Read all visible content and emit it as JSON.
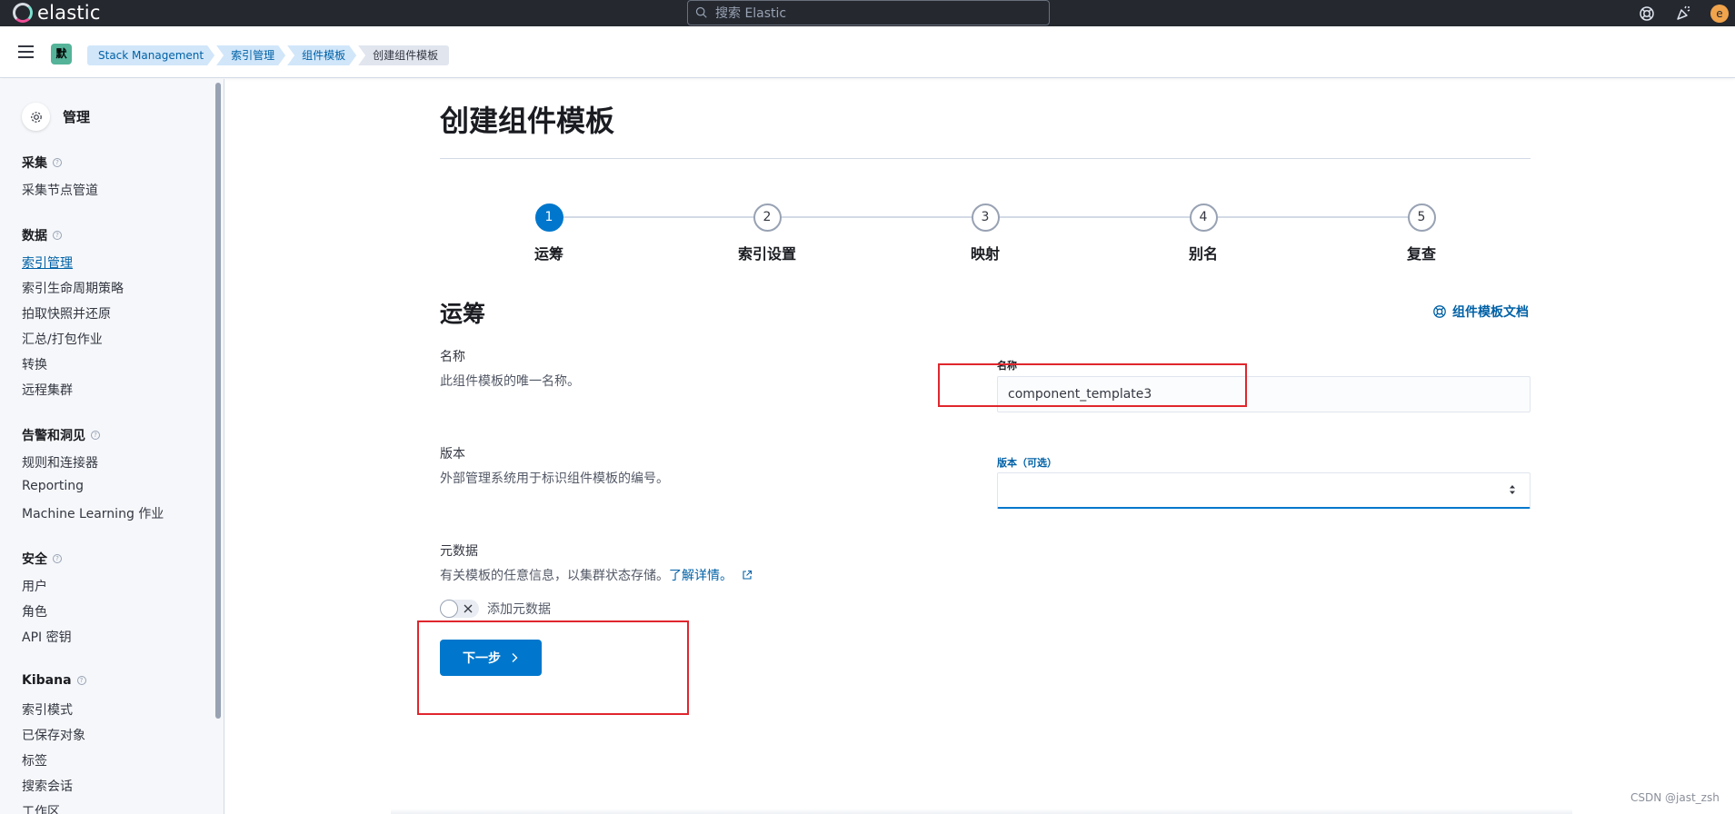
{
  "header": {
    "logo_text": "elastic",
    "search_placeholder": "搜索 Elastic",
    "avatar_initial": "e",
    "icons": [
      "help-icon",
      "newsfeed-icon"
    ]
  },
  "breadcrumb": {
    "space_badge": "默",
    "items": [
      "Stack Management",
      "索引管理",
      "组件模板",
      "创建组件模板"
    ]
  },
  "sidebar": {
    "title": "管理",
    "groups": [
      {
        "label": "采集",
        "items": [
          "采集节点管道"
        ]
      },
      {
        "label": "数据",
        "items": [
          "索引管理",
          "索引生命周期策略",
          "拍取快照并还原",
          "汇总/打包作业",
          "转换",
          "远程集群"
        ]
      },
      {
        "label": "告警和洞见",
        "items": [
          "规则和连接器",
          "Reporting",
          "Machine Learning 作业"
        ]
      },
      {
        "label": "安全",
        "items": [
          "用户",
          "角色",
          "API 密钥"
        ]
      },
      {
        "label": "Kibana",
        "items": [
          "索引模式",
          "已保存对象",
          "标签",
          "搜索会话",
          "工作区"
        ]
      }
    ],
    "active_item": "索引管理"
  },
  "main": {
    "page_title": "创建组件模板",
    "steps": [
      {
        "number": "1",
        "label": "运筹",
        "current": true
      },
      {
        "number": "2",
        "label": "索引设置"
      },
      {
        "number": "3",
        "label": "映射"
      },
      {
        "number": "4",
        "label": "别名"
      },
      {
        "number": "5",
        "label": "复查"
      }
    ],
    "section_title": "运筹",
    "doc_link": "组件模板文档",
    "name_field": {
      "title": "名称",
      "description": "此组件模板的唯一名称。",
      "label": "名称",
      "value": "component_template3"
    },
    "version_field": {
      "title": "版本",
      "description": "外部管理系统用于标识组件模板的编号。",
      "label": "版本（可选）",
      "value": ""
    },
    "metadata_field": {
      "title": "元数据",
      "description": "有关模板的任意信息，以集群状态存储。",
      "learn_more": "了解详情。",
      "switch_label": "添加元数据",
      "switch_on": false
    },
    "next_button": "下一步"
  },
  "watermark": "CSDN @jast_zsh",
  "colors": {
    "header_bg": "#25282f",
    "primary": "#0077cc",
    "link": "#0061a6",
    "annotation_red": "#e0262d"
  }
}
